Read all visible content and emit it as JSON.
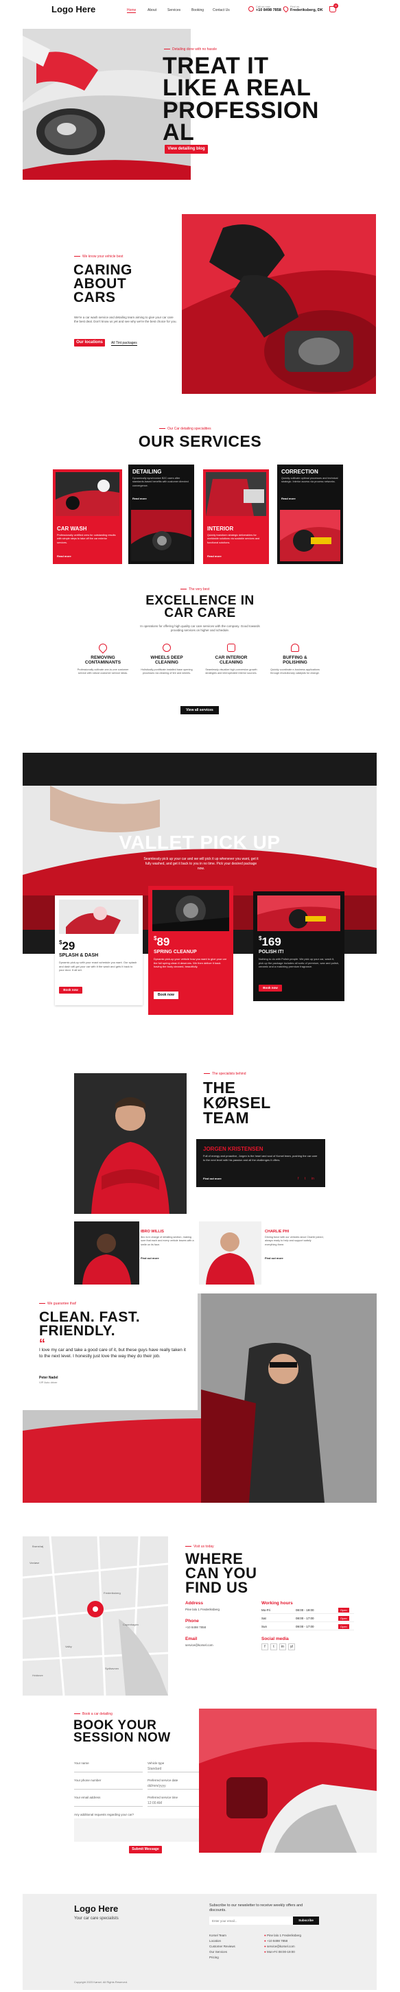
{
  "header": {
    "logo": "Logo Here",
    "nav": [
      "Home",
      "About",
      "Services",
      "Booking",
      "Contact Us"
    ],
    "phone_label": "Call us now",
    "phone": "+10 8498 7858",
    "address_label": "Find us",
    "address": "Frederiksberg, DK",
    "cart_count": "0"
  },
  "hero": {
    "kicker": "Detailing done with no hassle",
    "title_lines": [
      "TREAT IT",
      "LIKE A REAL",
      "PROFESSION",
      "AL"
    ],
    "cta": "View detailing blog"
  },
  "about": {
    "kicker": "We know your vehicle best",
    "title_lines": [
      "CARING",
      "ABOUT",
      "CARS"
    ],
    "text": "We're a car wash service and detailing team aiming to give your car care the best deal. Don't know us yet and see why we're the best choice for you.",
    "btn_primary": "Our locations",
    "btn_secondary": "All Tint packages"
  },
  "services": {
    "kicker": "Our Car detailing specialities",
    "title": "OUR SERVICES",
    "cards": [
      {
        "name": "CAR WASH",
        "text": "Professionally certified crew for outstanding results with simple steps to take off the car exterior services.",
        "link": "Read more"
      },
      {
        "name": "DETAILING",
        "text": "Dynamically synchronize B2C users after standards-based benefits with customer directed convergence.",
        "link": "Read more"
      },
      {
        "name": "INTERIOR",
        "text": "Quickly transform strategic deliverables for worldwide solutions via scalable services and functional solutions.",
        "link": "Read more"
      },
      {
        "name": "CORRECTION",
        "text": "Quickly cultivate optimal processes and technical strategic. Interior access via process networks.",
        "link": "Read more"
      }
    ]
  },
  "excellence": {
    "kicker": "The very best",
    "title_lines": [
      "EXCELLENCE IN",
      "CAR CARE"
    ],
    "text": "In operations for offering high quality car care services with the company. Good towards providing services on higher and schedule.",
    "features": [
      {
        "title_lines": [
          "REMOVING",
          "CONTAMINANTS"
        ],
        "text": "Professionally cultivate one-to-one customer service with robust customer service ideas."
      },
      {
        "title_lines": [
          "WHEELS DEEP",
          "CLEANING"
        ],
        "text": "Holistically pontificate installed base opening processes via cleaning of tire and wheels."
      },
      {
        "title_lines": [
          "CAR INTERIOR",
          "CLEANING"
        ],
        "text": "Seamlessly visualize high-conversion growth strategies and interoperable interior sources."
      },
      {
        "title_lines": [
          "BUFFING &",
          "POLISHING"
        ],
        "text": "Quickly coordinate e-business applications through revolutionary catalysts for change."
      }
    ],
    "cta": "View all services"
  },
  "valet": {
    "title": "VALLET PICK UP",
    "text": "Seamlessly pick up your car and we will pick it up whenever you want, get it fully washed, and get it back to you in no time. Pick your desired package now.",
    "packages": [
      {
        "price": "29",
        "name": "SPLASH & DASH",
        "text": "Dynamic pick-up with your exact schedule you want. Our splash and dash will get your car with it the wash and gets it back to your door. It all set.",
        "cta": "Book now"
      },
      {
        "price": "89",
        "name": "SPRING CLEANUP",
        "text": "Dynamic pick-up your vehicle how you want to give your car the full spring clean it deserves. We then deliver it back having the body cleaned, beautifully.",
        "cta": "Book now"
      },
      {
        "price": "169",
        "name": "POLISH IT!",
        "text": "Nothing to do with Polish people. We pick up your car, wash it, pick up the package includes all sorts of premium, wax and polish, ceramic and a matching premium fragrance.",
        "cta": "Book now"
      }
    ]
  },
  "team": {
    "kicker": "The specialists behind",
    "title_lines": [
      "THE",
      "KØRSEL",
      "TEAM"
    ],
    "lead": {
      "name": "JORGEN KRISTENSEN",
      "text": "Full of energy and proactive, Jorgen is the heart and soul of Korsel team, pushing the car care to the next level with his passion and all the challenges it offers.",
      "link": "Find out more"
    },
    "members": [
      {
        "name": "IBRO WILLIS",
        "text": "Ibro is in charge of detailing section, making sure that each and every vehicle leaves with a smile on its face.",
        "link": "Find out more"
      },
      {
        "name": "CHARLIE PHI",
        "text": "Driving force with our vehicles since Charlie joined, always ready to help and support satisfy everything there.",
        "link": "Find out more"
      }
    ]
  },
  "testimonial": {
    "kicker": "We guarantee that!",
    "title_lines": [
      "CLEAN. FAST.",
      "FRIENDLY."
    ],
    "quote": "I love my car and take a good care of it, but these guys have really taken it to the next level. I honestly just love the way they do their job.",
    "author": "Peter Nadel",
    "author_role": "VIP Auto driver"
  },
  "location": {
    "kicker": "Visit us today",
    "title_lines": [
      "WHERE",
      "CAN YOU",
      "FIND US"
    ],
    "address_label": "Address",
    "address": "Pine lalo 1 Frederiksberg",
    "phone_label": "Phone",
    "phone": "+10 8498 7858",
    "email_label": "Email",
    "email": "service@korsel.com",
    "hours_label": "Working hours",
    "hours": [
      {
        "days": "Mo-Fri",
        "time": "08:00 - 19:00",
        "badge": "Open"
      },
      {
        "days": "Sat",
        "time": "08:00 - 17:00",
        "badge": "Open"
      },
      {
        "days": "Sun",
        "time": "09:00 - 17:00",
        "badge": "Open"
      }
    ],
    "social_label": "Social media",
    "social": [
      "f",
      "t",
      "in",
      "yt"
    ],
    "map_labels": [
      "Vanløse",
      "Frederiksberg",
      "Valby",
      "Copenhagen",
      "Sydhavnen",
      "Hvidovre",
      "Brønshøj"
    ]
  },
  "booking": {
    "kicker": "Book a car detailing",
    "title_lines": [
      "BOOK YOUR",
      "SESSION NOW"
    ],
    "fields": [
      {
        "label": "Your name",
        "placeholder": ""
      },
      {
        "label": "Vehicle type",
        "placeholder": "Standard"
      },
      {
        "label": "Your phone number",
        "placeholder": ""
      },
      {
        "label": "Preferred service date",
        "placeholder": "dd/mm/yyyy"
      },
      {
        "label": "Your email address",
        "placeholder": ""
      },
      {
        "label": "Preferred service time",
        "placeholder": "12:00 AM"
      }
    ],
    "message_label": "Any additional requests regarding your car?",
    "submit": "Submit Message"
  },
  "footer": {
    "logo": "Logo Here",
    "tagline": "Your car care specialists",
    "newsletter_text": "Subscribe to our newsletter to receive weekly offers and discounts.",
    "email_placeholder": "Enter your email...",
    "subscribe": "Subscribe",
    "links": [
      "Korsel Team",
      "Location",
      "Customer Reviews",
      "Our Services",
      "Pricing"
    ],
    "contact": [
      "Pine lalo 1 Frederiksberg",
      "+10 8498 7858",
      "service@korsel.com",
      "Mon-Fri 08:00-19:00"
    ],
    "copyright": "Copyright 2023 Kørsel. All Rights Reserved."
  },
  "colors": {
    "accent": "#e3152b",
    "dark": "#111111",
    "light_gray": "#efefef"
  }
}
